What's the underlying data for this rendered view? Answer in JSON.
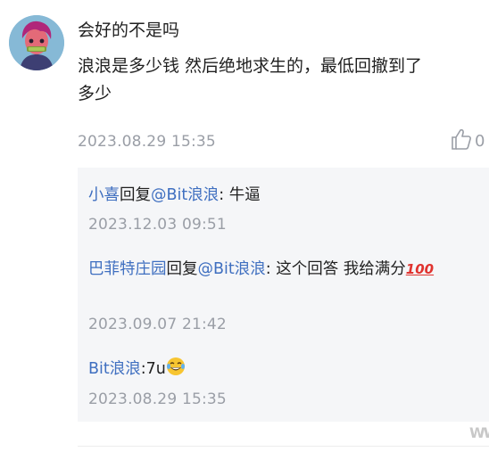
{
  "comment": {
    "line1": "会好的不是吗",
    "line2": "浪浪是多少钱 然后绝地求生的，最低回撤到了",
    "line3": "多少",
    "time": "2023.08.29 15:35",
    "like_count": "0"
  },
  "replies": [
    {
      "name": "小喜",
      "action": "回复",
      "target": "@Bit浪浪",
      "text": ": 牛逼",
      "time": "2023.12.03 09:51"
    },
    {
      "name": "巴菲特庄园",
      "action": "回复",
      "target": "@Bit浪浪",
      "text": ": 这个回答 我给满分",
      "emoji": "100",
      "time": "2023.09.07 21:42"
    },
    {
      "name": "Bit浪浪",
      "text": ":7u",
      "emoji": "laughing-tears",
      "time": "2023.08.29 15:35"
    }
  ],
  "watermark": "WW",
  "icons": {
    "like": "thumbs-up-icon"
  },
  "colors": {
    "username": "#3f6fc0",
    "timestamp": "#9a9ea6",
    "reply_background": "#f5f6f8"
  }
}
